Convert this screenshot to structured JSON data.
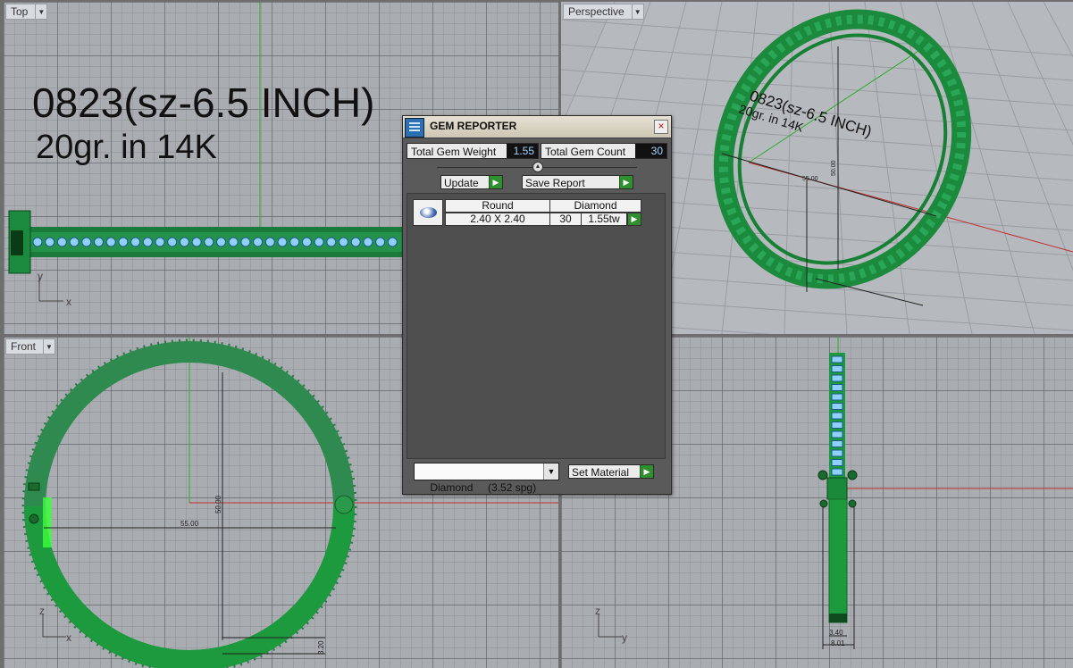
{
  "viewports": {
    "top": {
      "label": "Top",
      "axis_h": "x",
      "axis_v": "y"
    },
    "perspective": {
      "label": "Perspective"
    },
    "front": {
      "label": "Front",
      "axis_h": "x",
      "axis_v": "z",
      "dim_width": "55.00",
      "dim_height": "50.00",
      "dim_thickness": "3.20"
    },
    "right": {
      "axis_h": "y",
      "axis_v": "z",
      "dim_inner": "3.40",
      "dim_width": "8.01"
    }
  },
  "annotation": {
    "line1": "0823(sz-6.5 INCH)",
    "line2": "20gr.  in 14K"
  },
  "persp_annotation": {
    "line1": "0823(sz-6.5 INCH)",
    "line2": "20gr.  in 14K",
    "dim_a": "55.00",
    "dim_b": "50.00"
  },
  "gem_reporter": {
    "title": "GEM REPORTER",
    "close_glyph": "×",
    "total_weight_label": "Total Gem Weight",
    "total_weight_value": "1.55",
    "total_count_label": "Total Gem Count",
    "total_count_value": "30",
    "update_label": "Update",
    "save_report_label": "Save Report",
    "gem_row": {
      "shape": "Round",
      "material": "Diamond",
      "size": "2.40 X 2.40",
      "count": "30",
      "weight": "1.55tw"
    },
    "material_select": "Diamond     (3.52 spg)",
    "set_material_label": "Set Material"
  },
  "colors": {
    "green": "#1e9a3e",
    "cyan_gem": "#8fd0ff",
    "red_axis": "#c23030",
    "green_axis": "#2eaa2e"
  }
}
